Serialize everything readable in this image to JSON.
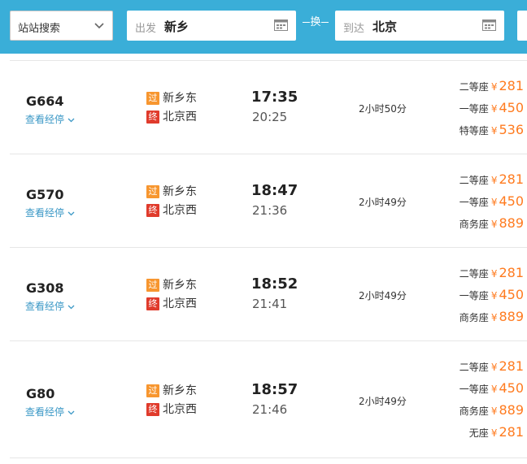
{
  "search": {
    "type_value": "站站搜索",
    "from_label": "出发",
    "from_city": "新乡",
    "swap_label": "换",
    "to_label": "到达",
    "to_city": "北京"
  },
  "trains": [
    {
      "number": "G664",
      "stops_link": "查看经停",
      "from_tag": "过",
      "from_station": "新乡东",
      "to_tag": "终",
      "to_station": "北京西",
      "depart": "17:35",
      "arrive": "20:25",
      "duration": "2小时50分",
      "fares": [
        {
          "class": "二等座",
          "currency": "¥",
          "price": "281"
        },
        {
          "class": "一等座",
          "currency": "¥",
          "price": "450"
        },
        {
          "class": "特等座",
          "currency": "¥",
          "price": "536"
        }
      ]
    },
    {
      "number": "G570",
      "stops_link": "查看经停",
      "from_tag": "过",
      "from_station": "新乡东",
      "to_tag": "终",
      "to_station": "北京西",
      "depart": "18:47",
      "arrive": "21:36",
      "duration": "2小时49分",
      "fares": [
        {
          "class": "二等座",
          "currency": "¥",
          "price": "281"
        },
        {
          "class": "一等座",
          "currency": "¥",
          "price": "450"
        },
        {
          "class": "商务座",
          "currency": "¥",
          "price": "889"
        }
      ]
    },
    {
      "number": "G308",
      "stops_link": "查看经停",
      "from_tag": "过",
      "from_station": "新乡东",
      "to_tag": "终",
      "to_station": "北京西",
      "depart": "18:52",
      "arrive": "21:41",
      "duration": "2小时49分",
      "fares": [
        {
          "class": "二等座",
          "currency": "¥",
          "price": "281"
        },
        {
          "class": "一等座",
          "currency": "¥",
          "price": "450"
        },
        {
          "class": "商务座",
          "currency": "¥",
          "price": "889"
        }
      ]
    },
    {
      "number": "G80",
      "stops_link": "查看经停",
      "from_tag": "过",
      "from_station": "新乡东",
      "to_tag": "终",
      "to_station": "北京西",
      "depart": "18:57",
      "arrive": "21:46",
      "duration": "2小时49分",
      "fares": [
        {
          "class": "二等座",
          "currency": "¥",
          "price": "281"
        },
        {
          "class": "一等座",
          "currency": "¥",
          "price": "450"
        },
        {
          "class": "商务座",
          "currency": "¥",
          "price": "889"
        },
        {
          "class": "无座",
          "currency": "¥",
          "price": "281"
        }
      ]
    }
  ],
  "colors": {
    "header_bg": "#3aaed8",
    "price": "#ff7b1f",
    "link": "#3b98c6",
    "pass_tag": "#f7962f",
    "end_tag": "#e03b2c"
  },
  "icons": {
    "dropdown": "chevron-down-icon",
    "calendar": "calendar-icon",
    "stops_toggle": "chevron-down-icon"
  }
}
